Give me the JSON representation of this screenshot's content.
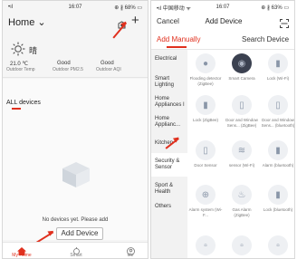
{
  "left": {
    "status": {
      "signal": "•ıl",
      "time": "16:07",
      "battery": "⊕ ∦ 68% ▭"
    },
    "header": {
      "title": "Home ⌄"
    },
    "weather": {
      "condition": "晴",
      "temp_value": "21.0 ℃",
      "temp_label": "Outdoor Temp",
      "pm_value": "Good",
      "pm_label": "Outdoor PM2.5",
      "aqi_value": "Good",
      "aqi_label": "Outdoor AQI"
    },
    "devices_title": "ALL devices",
    "empty_text": "No devices yet. Please add",
    "add_button": "Add Device",
    "nav": [
      {
        "label": "My Home",
        "icon": "home-icon"
      },
      {
        "label": "Smart",
        "icon": "smart-icon"
      },
      {
        "label": "Me",
        "icon": "me-icon"
      }
    ]
  },
  "right": {
    "status": {
      "carrier": "•ıl 中国移动 ᯤ",
      "time": "16:07",
      "battery": "⊕ ∦ 63% ▭"
    },
    "header": {
      "cancel": "Cancel",
      "title": "Add Device"
    },
    "tabs": {
      "manual": "Add Manually",
      "search": "Search Device"
    },
    "categories": [
      "Electrical",
      "Smart Lighting",
      "Home Appliances I",
      "Home Applianc...",
      "Kitchen",
      "Security & Sensor",
      "Sport & Health",
      "Others"
    ],
    "tiles": [
      {
        "label": "Flooding detector (ZigBee)",
        "icon": "sensor-icon"
      },
      {
        "label": "Smart Camera",
        "icon": "camera-icon"
      },
      {
        "label": "Lock (Wi-Fi)",
        "icon": "lock-icon"
      },
      {
        "label": "Lock (ZigBee)",
        "icon": "lock-icon"
      },
      {
        "label": "Door and Window Sens... (ZigBee)",
        "icon": "door-sensor-icon"
      },
      {
        "label": "Door and Window Sens... (bluetooth)",
        "icon": "door-sensor-icon"
      },
      {
        "label": "Door Sensor",
        "icon": "door-sensor-icon"
      },
      {
        "label": "sensor (Wi-Fi)",
        "icon": "sensor-icon"
      },
      {
        "label": "Alarm (bluetooth)",
        "icon": "alarm-icon"
      },
      {
        "label": "Alarm system (Wi-F...",
        "icon": "alarm-icon"
      },
      {
        "label": "Gas Alarm (ZigBee)",
        "icon": "gas-alarm-icon"
      },
      {
        "label": "Lock (bluetooth)",
        "icon": "lock-icon"
      }
    ]
  }
}
